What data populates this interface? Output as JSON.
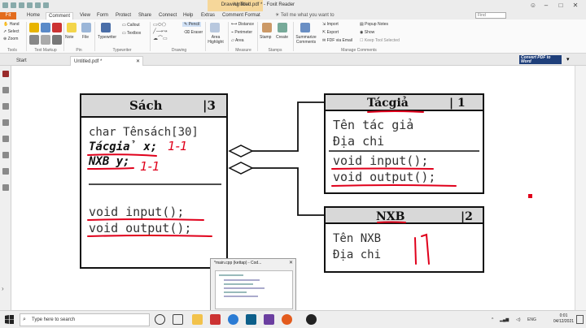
{
  "window": {
    "title": "Untitled.pdf * - Foxit Reader",
    "context_tab": "Drawing Tool"
  },
  "tabs": [
    "Fit",
    "Home",
    "Comment",
    "View",
    "Form",
    "Protect",
    "Share",
    "Connect",
    "Help",
    "Extras",
    "Comment Format"
  ],
  "tell_me": "Tell me what you want to",
  "find": "Find",
  "ribbon": {
    "text_markup": [
      "Hand",
      "Select",
      "Zoom"
    ],
    "group_tools": "Tools",
    "group_text_markup": "Text Markup",
    "note": "Note",
    "file": "File",
    "group_pin": "Pin",
    "typewriter": "Typewriter",
    "callout": "Callout",
    "textbox": "Textbox",
    "group_typewriter": "Typewriter",
    "pencil": "Pencil",
    "eraser": "Eraser",
    "group_drawing": "Drawing",
    "area_highlight": "Area Highlight",
    "distance": "Distance",
    "perimeter": "Perimeter",
    "area": "Area",
    "group_measure": "Measure",
    "stamp": "Stamp",
    "create": "Create",
    "group_stamps": "Stamps",
    "summarize": "Summarize Comments",
    "import": "Import",
    "export": "Export",
    "fdf_email": "FDF via Email",
    "popup_notes": "Popup Notes",
    "show": "Show",
    "keep_tool": "Keep Tool Selected",
    "group_manage": "Manage Comments"
  },
  "doc_tabs": [
    "Start",
    "Untitled.pdf *"
  ],
  "convert_label": "Convert PDF to Word",
  "diagram": {
    "class_sach": {
      "name": "Sách",
      "mult": "|3",
      "attr1": "char Tênsách[30]",
      "attr2": "Tácgiả x;",
      "attr3": "NXB y;",
      "method1": "void input();",
      "method2": "void output();",
      "ann1": "1-1",
      "ann2": "1-1"
    },
    "class_tacgia": {
      "name": "Tácgiả",
      "mult": "| 1",
      "attr1": "Tên tác giả",
      "attr2": "Địa chi",
      "method1": "void input();",
      "method2": "void output();"
    },
    "class_nxb": {
      "name": "NXB",
      "mult": "|2",
      "attr1": "Tên NXB",
      "attr2": "Địa chi"
    }
  },
  "thumbnail": {
    "title": "*main.cpp (kettap) - Cod..."
  },
  "taskbar": {
    "search_placeholder": "Type here to search",
    "lang": "ENG",
    "time": "0:01",
    "date": "04/12/2021"
  },
  "colors": {
    "file_tab": "#e36c1d",
    "context_tab": "#f6d79a",
    "ink": "#e0001b",
    "box_header": "#d8d8d8"
  }
}
